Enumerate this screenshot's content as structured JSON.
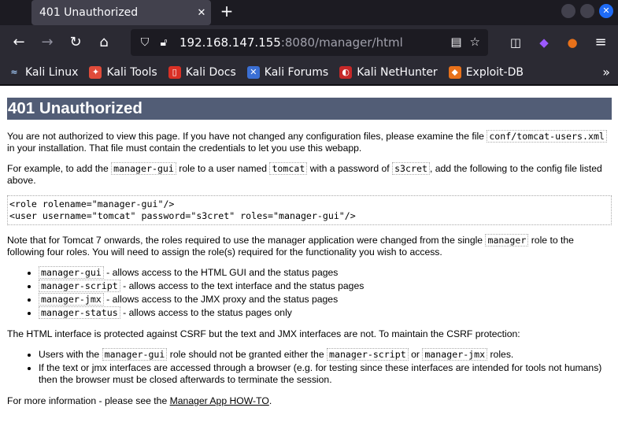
{
  "browser": {
    "tab_title": "401 Unauthorized",
    "url_host": "192.168.147.155",
    "url_rest": ":8080/manager/html",
    "bookmarks": [
      {
        "label": "Kali Linux",
        "icon": "kali-dragon-icon",
        "color": "#2e7bcf"
      },
      {
        "label": "Kali Tools",
        "icon": "kali-tools-icon",
        "color": "#e04b3a"
      },
      {
        "label": "Kali Docs",
        "icon": "kali-docs-icon",
        "color": "#d93025"
      },
      {
        "label": "Kali Forums",
        "icon": "kali-forums-icon",
        "color": "#3b6fd4"
      },
      {
        "label": "Kali NetHunter",
        "icon": "nethunter-icon",
        "color": "#c62828"
      },
      {
        "label": "Exploit-DB",
        "icon": "exploit-db-icon",
        "color": "#e8711a"
      }
    ]
  },
  "page": {
    "heading": "401 Unauthorized",
    "p1_a": "You are not authorized to view this page. If you have not changed any configuration files, please examine the file ",
    "p1_code": "conf/tomcat-users.xml",
    "p1_b": " in your installation. That file must contain the credentials to let you use this webapp.",
    "p2_a": "For example, to add the ",
    "p2_code1": "manager-gui",
    "p2_b": " role to a user named ",
    "p2_code2": "tomcat",
    "p2_c": " with a password of ",
    "p2_code3": "s3cret",
    "p2_d": ", add the following to the config file listed above.",
    "config_line1": "<role rolename=\"manager-gui\"/>",
    "config_line2": "<user username=\"tomcat\" password=\"s3cret\" roles=\"manager-gui\"/>",
    "p3_a": "Note that for Tomcat 7 onwards, the roles required to use the manager application were changed from the single ",
    "p3_code": "manager",
    "p3_b": " role to the following four roles. You will need to assign the role(s) required for the functionality you wish to access.",
    "roles": [
      {
        "code": "manager-gui",
        "desc": " - allows access to the HTML GUI and the status pages"
      },
      {
        "code": "manager-script",
        "desc": " - allows access to the text interface and the status pages"
      },
      {
        "code": "manager-jmx",
        "desc": " - allows access to the JMX proxy and the status pages"
      },
      {
        "code": "manager-status",
        "desc": " - allows access to the status pages only"
      }
    ],
    "p4": "The HTML interface is protected against CSRF but the text and JMX interfaces are not. To maintain the CSRF protection:",
    "csrf1_a": "Users with the ",
    "csrf1_code1": "manager-gui",
    "csrf1_b": " role should not be granted either the ",
    "csrf1_code2": "manager-script",
    "csrf1_c": " or ",
    "csrf1_code3": "manager-jmx",
    "csrf1_d": " roles.",
    "csrf2": "If the text or jmx interfaces are accessed through a browser (e.g. for testing since these interfaces are intended for tools not humans) then the browser must be closed afterwards to terminate the session.",
    "p5_a": "For more information - please see the ",
    "p5_link": "Manager App HOW-TO",
    "p5_b": "."
  }
}
